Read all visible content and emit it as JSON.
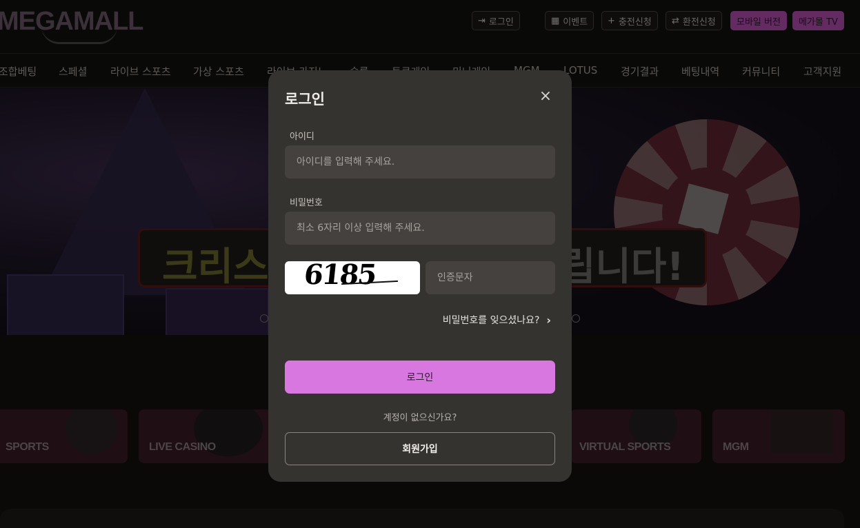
{
  "header": {
    "logo": "MEGAMALL",
    "buttons": [
      {
        "label": "로그인",
        "icon": "login-icon"
      },
      {
        "label": "이벤트",
        "icon": "gift-icon"
      },
      {
        "label": "충전신청",
        "icon": "plus-icon"
      },
      {
        "label": "환전신청",
        "icon": "exchange-icon"
      },
      {
        "label": "모바일 버전"
      },
      {
        "label": "메가몰 TV"
      }
    ]
  },
  "nav": {
    "items": [
      "조합베팅",
      "스페셜",
      "라이브 스포츠",
      "가상 스포츠",
      "라이브 카지노",
      "슬롯",
      "토큰게임",
      "미니게임",
      "MGM",
      "LOTUS",
      "경기결과",
      "베팅내역",
      "커뮤니티",
      "고객지원"
    ]
  },
  "banner": {
    "left_text": "크리스",
    "right_text": "립니다!"
  },
  "categories": [
    {
      "label": "SPORTS"
    },
    {
      "label": "LIVE CASINO"
    },
    {
      "label": "VIRTUAL SPORTS"
    },
    {
      "label": "MGM"
    }
  ],
  "modal": {
    "title": "로그인",
    "close": "×",
    "id_label": "아이디",
    "id_placeholder": "아이디를 입력해 주세요.",
    "pw_label": "비밀번호",
    "pw_placeholder": "최소 6자리 이상 입력해 주세요.",
    "captcha_value": "6185",
    "captcha_placeholder": "인증문자",
    "forgot": "비밀번호를 잊으셨나요?",
    "login_button": "로그인",
    "no_account": "계정이 없으신가요?",
    "signup_button": "회원가입"
  },
  "colors": {
    "accent_pink": "#d977e0",
    "header_pink": "#b64eb3",
    "modal_bg": "#353330"
  }
}
